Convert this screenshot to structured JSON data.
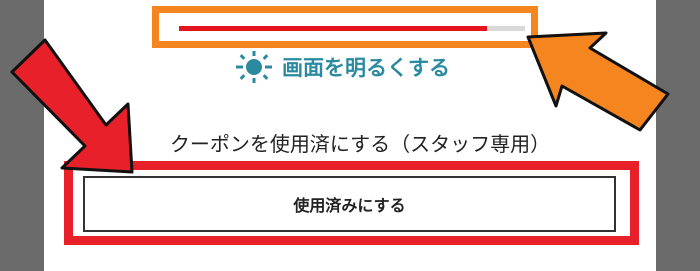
{
  "brightness": {
    "label": "画面を明るくする",
    "icon": "sun-icon",
    "color": "#2b8aa0"
  },
  "progress": {
    "fill_fraction": 0.89,
    "fill_color": "#e4141e",
    "highlight_color": "#f5851f"
  },
  "coupon": {
    "title": "クーポンを使用済にする（スタッフ専用）",
    "use_button_label": "使用済みにする",
    "highlight_color": "#e8202a"
  },
  "annotations": {
    "red_arrow_icon": "arrow-down-right-icon",
    "orange_arrow_icon": "arrow-up-left-icon"
  }
}
